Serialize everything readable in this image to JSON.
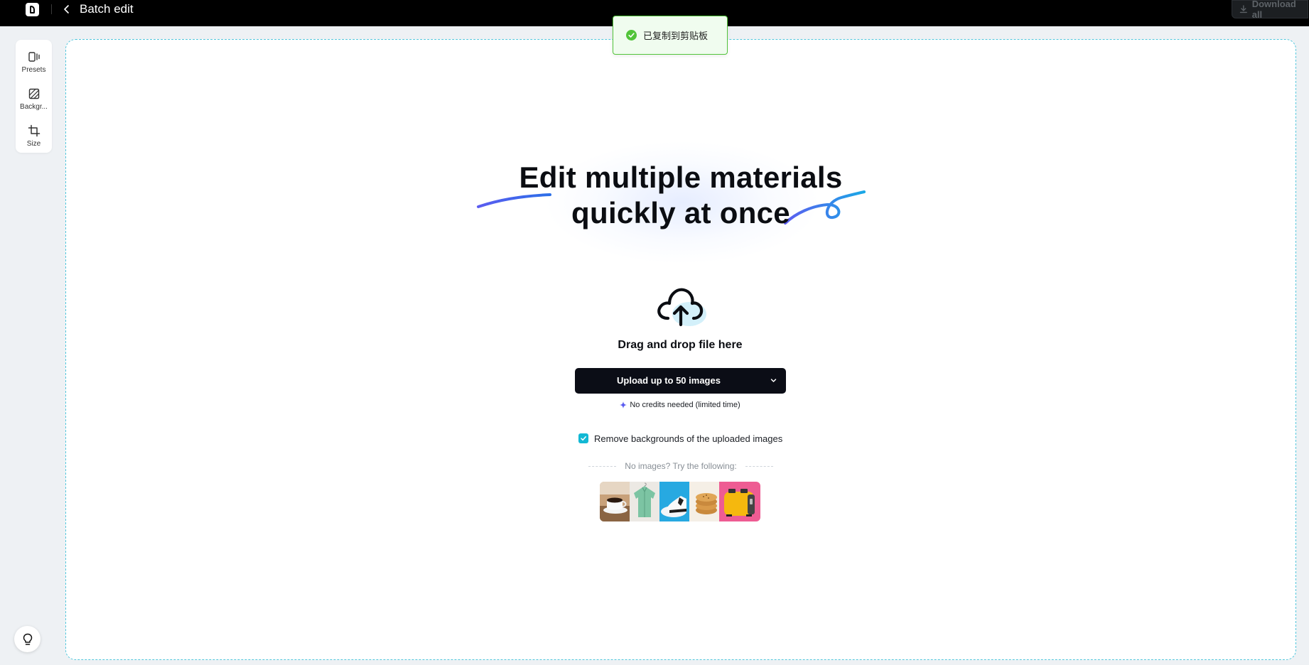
{
  "topbar": {
    "title": "Batch edit",
    "download_label": "Download all"
  },
  "toolbar": {
    "items": [
      {
        "label": "Presets",
        "icon": "presets-icon"
      },
      {
        "label": "Backgr...",
        "icon": "background-icon"
      },
      {
        "label": "Size",
        "icon": "crop-icon"
      }
    ]
  },
  "main": {
    "headline_line1": "Edit multiple materials",
    "headline_line2": "quickly at once",
    "drag_text": "Drag and drop file here",
    "upload_label": "Upload up to 50 images",
    "credits_text": "No credits needed (limited time)",
    "remove_bg_label": "Remove backgrounds of the uploaded images",
    "remove_bg_checked": true,
    "try_text": "No images? Try the following:",
    "samples": [
      "coffee",
      "shirt",
      "sneaker",
      "cookies",
      "toaster"
    ]
  },
  "toast": {
    "message": "已复制到剪贴板"
  },
  "colors": {
    "accent": "#12b8d4",
    "topbar": "#000000",
    "dashed_border": "#52c6dc",
    "toast_border": "#52c43a",
    "swoosh_start": "#5b5cf0",
    "swoosh_end": "#1aa8e6"
  }
}
